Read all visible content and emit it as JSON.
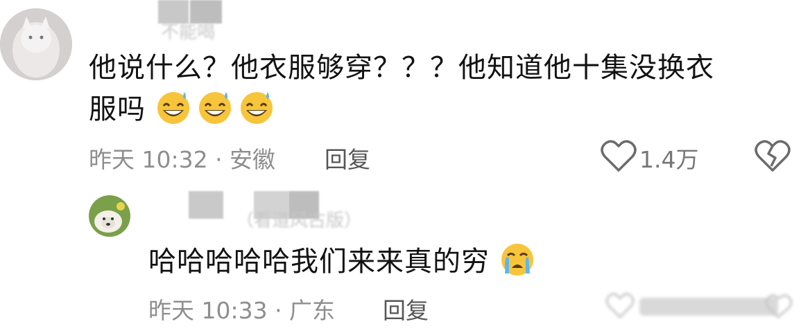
{
  "comment1": {
    "username": "不能喝",
    "text_line1": "他说什么？他衣服够穿？？？他知道他十集没换衣",
    "text_line2": "服吗",
    "emojis": [
      "grin-sweat-emoji",
      "grin-sweat-emoji",
      "grin-sweat-emoji"
    ],
    "time_location": "昨天 10:32 · 安徽",
    "reply_label": "回复",
    "like_count": "1.4万"
  },
  "comment2": {
    "username": "（看道风古版）",
    "text": "哈哈哈哈哈我们来来真的穷",
    "emojis": [
      "crying-emoji"
    ],
    "time_location": "昨天 10:33 · 广东",
    "reply_label": "回复"
  },
  "colors": {
    "text": "#121212",
    "meta": "#8e8e8e",
    "emoji_yellow": "#f7c53b"
  }
}
